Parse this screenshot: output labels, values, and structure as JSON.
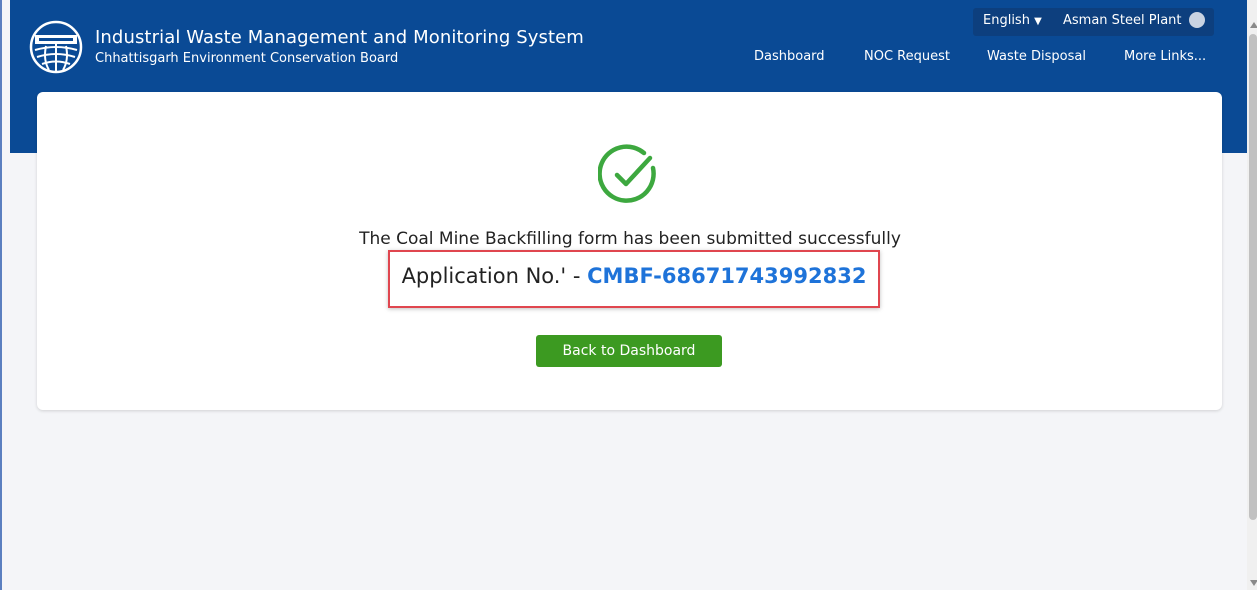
{
  "header": {
    "title": "Industrial Waste Management and Monitoring System",
    "subtitle": "Chhattisgarh Environment Conservation Board",
    "logo_icon": "cecb-globe-logo"
  },
  "top_bar": {
    "language": "English",
    "user_name": "Asman Steel Plant",
    "user_icon": "user-avatar-icon"
  },
  "nav": {
    "items": [
      "Dashboard",
      "NOC Request",
      "Waste Disposal",
      "More Links..."
    ]
  },
  "main": {
    "message": "The Coal Mine Backfilling form has been submitted successfully",
    "app_label": "Application No.' - ",
    "app_number": "CMBF-68671743992832",
    "back_button": "Back to Dashboard"
  },
  "colors": {
    "header_bg": "#0a4a95",
    "success_green": "#3da83f",
    "button_green": "#3c9a21",
    "link_blue": "#1e73d9",
    "highlight_red": "#e0464f"
  }
}
